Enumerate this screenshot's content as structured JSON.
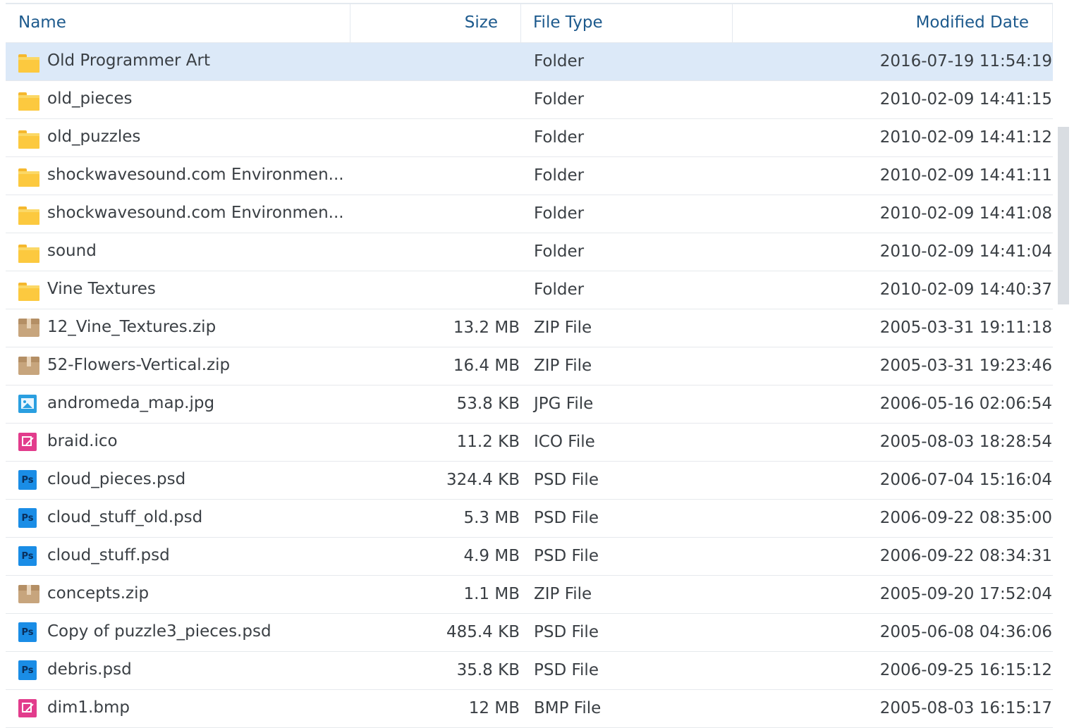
{
  "columns": {
    "name": "Name",
    "size": "Size",
    "type": "File Type",
    "date": "Modified Date"
  },
  "rows": [
    {
      "icon": "folder-icon",
      "kind": "folder",
      "name": "Old Programmer Art",
      "size": "",
      "type": "Folder",
      "date": "2016-07-19 11:54:19"
    },
    {
      "icon": "folder-icon",
      "kind": "folder",
      "name": "old_pieces",
      "size": "",
      "type": "Folder",
      "date": "2010-02-09 14:41:15"
    },
    {
      "icon": "folder-icon",
      "kind": "folder",
      "name": "old_puzzles",
      "size": "",
      "type": "Folder",
      "date": "2010-02-09 14:41:12"
    },
    {
      "icon": "folder-icon",
      "kind": "folder",
      "name": "shockwavesound.com Environmen...",
      "size": "",
      "type": "Folder",
      "date": "2010-02-09 14:41:11"
    },
    {
      "icon": "folder-icon",
      "kind": "folder",
      "name": "shockwavesound.com Environmen...",
      "size": "",
      "type": "Folder",
      "date": "2010-02-09 14:41:08"
    },
    {
      "icon": "folder-icon",
      "kind": "folder",
      "name": "sound",
      "size": "",
      "type": "Folder",
      "date": "2010-02-09 14:41:04"
    },
    {
      "icon": "folder-icon",
      "kind": "folder",
      "name": "Vine Textures",
      "size": "",
      "type": "Folder",
      "date": "2010-02-09 14:40:37"
    },
    {
      "icon": "zip-icon",
      "kind": "zip",
      "name": "12_Vine_Textures.zip",
      "size": "13.2 MB",
      "type": "ZIP File",
      "date": "2005-03-31 19:11:18"
    },
    {
      "icon": "zip-icon",
      "kind": "zip",
      "name": "52-Flowers-Vertical.zip",
      "size": "16.4 MB",
      "type": "ZIP File",
      "date": "2005-03-31 19:23:46"
    },
    {
      "icon": "image-icon",
      "kind": "img",
      "name": "andromeda_map.jpg",
      "size": "53.8 KB",
      "type": "JPG File",
      "date": "2006-05-16 02:06:54"
    },
    {
      "icon": "edit-image-icon",
      "kind": "ico",
      "name": "braid.ico",
      "size": "11.2 KB",
      "type": "ICO File",
      "date": "2005-08-03 18:28:54"
    },
    {
      "icon": "photoshop-icon",
      "kind": "ps",
      "name": "cloud_pieces.psd",
      "size": "324.4 KB",
      "type": "PSD File",
      "date": "2006-07-04 15:16:04"
    },
    {
      "icon": "photoshop-icon",
      "kind": "ps",
      "name": "cloud_stuff_old.psd",
      "size": "5.3 MB",
      "type": "PSD File",
      "date": "2006-09-22 08:35:00"
    },
    {
      "icon": "photoshop-icon",
      "kind": "ps",
      "name": "cloud_stuff.psd",
      "size": "4.9 MB",
      "type": "PSD File",
      "date": "2006-09-22 08:34:31"
    },
    {
      "icon": "zip-icon",
      "kind": "zip",
      "name": "concepts.zip",
      "size": "1.1 MB",
      "type": "ZIP File",
      "date": "2005-09-20 17:52:04"
    },
    {
      "icon": "photoshop-icon",
      "kind": "ps",
      "name": "Copy of puzzle3_pieces.psd",
      "size": "485.4 KB",
      "type": "PSD File",
      "date": "2005-06-08 04:36:06"
    },
    {
      "icon": "photoshop-icon",
      "kind": "ps",
      "name": "debris.psd",
      "size": "35.8 KB",
      "type": "PSD File",
      "date": "2006-09-25 16:15:12"
    },
    {
      "icon": "edit-image-icon",
      "kind": "ico",
      "name": "dim1.bmp",
      "size": "12 MB",
      "type": "BMP File",
      "date": "2005-08-03 16:15:17"
    }
  ],
  "ps_label": "Ps",
  "selected_index": 0
}
